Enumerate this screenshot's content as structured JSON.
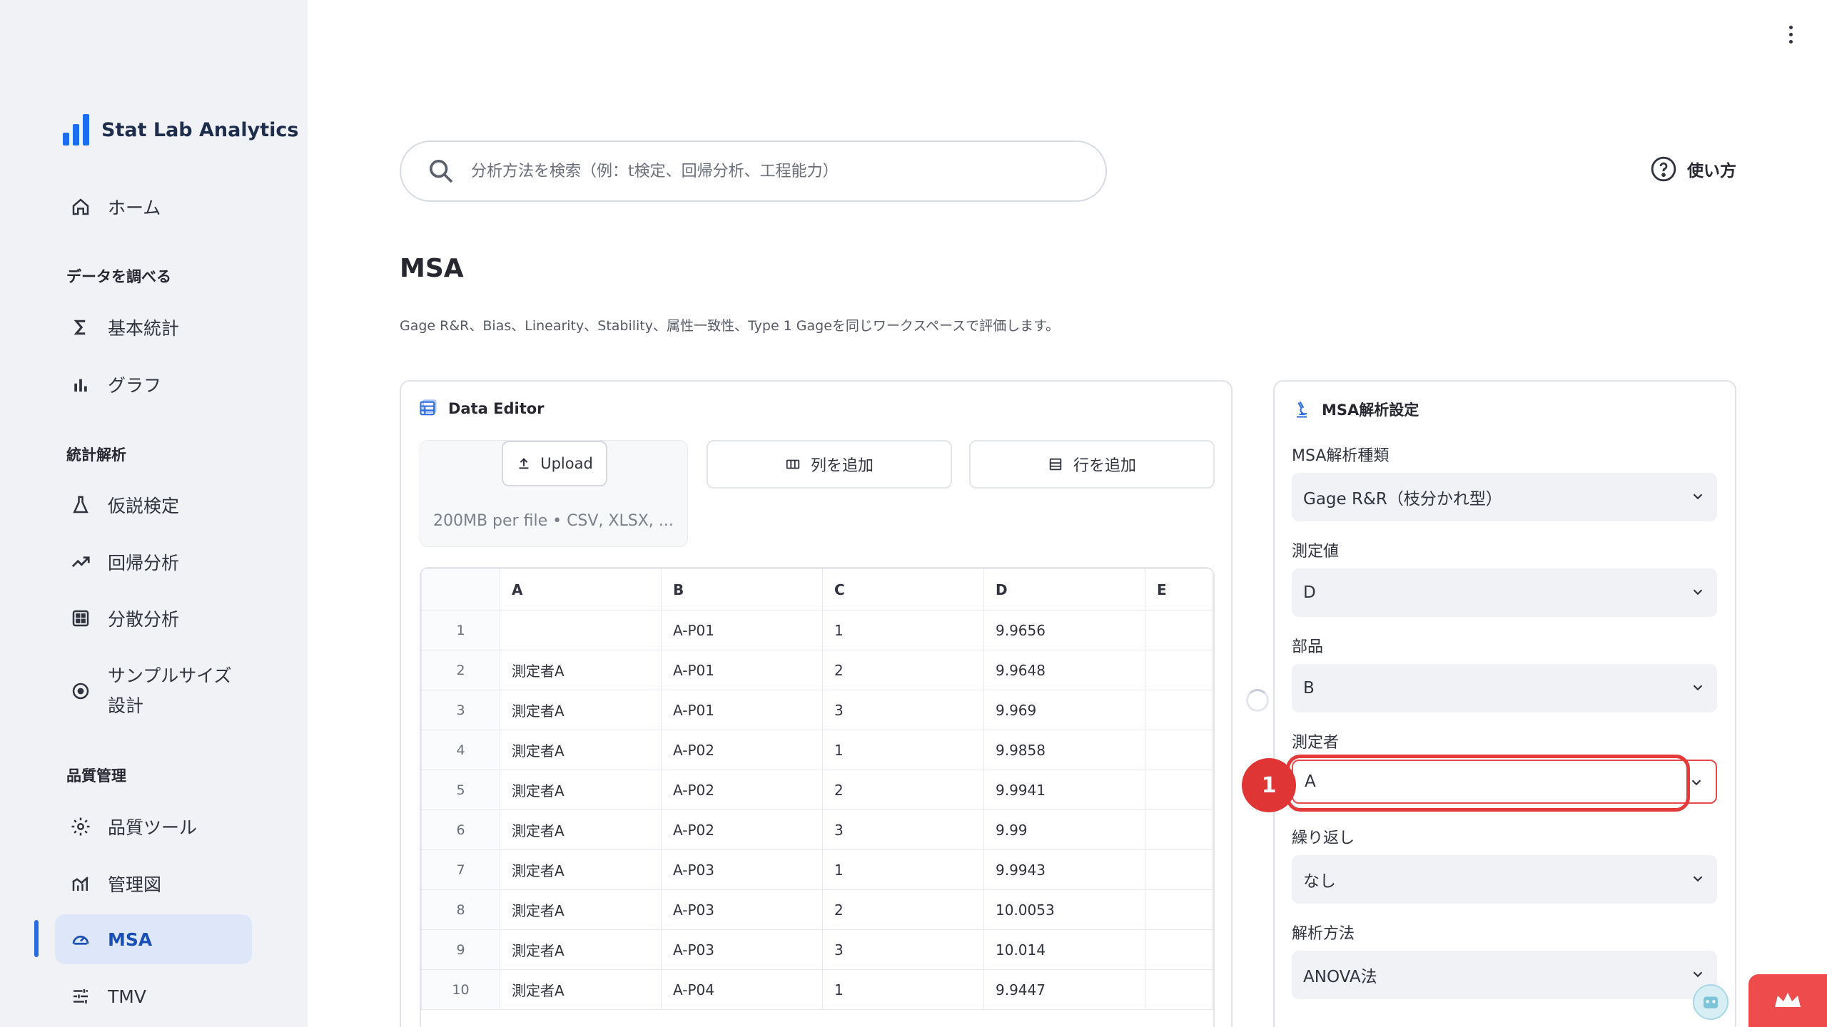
{
  "brand": {
    "name": "Stat Lab Analytics"
  },
  "sidebar": {
    "home": "ホーム",
    "section_explore": "データを調べる",
    "basic_stats": "基本統計",
    "graph": "グラフ",
    "section_stats": "統計解析",
    "hypothesis": "仮説検定",
    "regression": "回帰分析",
    "anova": "分散分析",
    "sample_size": "サンプルサイズ",
    "sample_size_2": "設計",
    "section_quality": "品質管理",
    "quality_tools": "品質ツール",
    "control_chart": "管理図",
    "msa": "MSA",
    "tmv": "TMV"
  },
  "search": {
    "placeholder": "分析方法を検索（例：t検定、回帰分析、工程能力）"
  },
  "help": {
    "label": "使い方"
  },
  "page": {
    "title": "MSA",
    "description": "Gage R&R、Bias、Linearity、Stability、属性一致性、Type 1 Gageを同じワークスペースで評価します。"
  },
  "editor": {
    "title": "Data Editor",
    "upload_label": "Upload",
    "upload_hint": "200MB per file • CSV, XLSX, ...",
    "add_column": "列を追加",
    "add_row": "行を追加",
    "columns": [
      "",
      "A",
      "B",
      "C",
      "D",
      "E"
    ],
    "rows": [
      [
        "1",
        "",
        "A-P01",
        "1",
        "9.9656",
        ""
      ],
      [
        "2",
        "測定者A",
        "A-P01",
        "2",
        "9.9648",
        ""
      ],
      [
        "3",
        "測定者A",
        "A-P01",
        "3",
        "9.969",
        ""
      ],
      [
        "4",
        "測定者A",
        "A-P02",
        "1",
        "9.9858",
        ""
      ],
      [
        "5",
        "測定者A",
        "A-P02",
        "2",
        "9.9941",
        ""
      ],
      [
        "6",
        "測定者A",
        "A-P02",
        "3",
        "9.99",
        ""
      ],
      [
        "7",
        "測定者A",
        "A-P03",
        "1",
        "9.9943",
        ""
      ],
      [
        "8",
        "測定者A",
        "A-P03",
        "2",
        "10.0053",
        ""
      ],
      [
        "9",
        "測定者A",
        "A-P03",
        "3",
        "10.014",
        ""
      ],
      [
        "10",
        "測定者A",
        "A-P04",
        "1",
        "9.9447",
        ""
      ]
    ]
  },
  "settings": {
    "title": "MSA解析設定",
    "type_label": "MSA解析種類",
    "type_value": "Gage R&R（枝分かれ型）",
    "measure_label": "測定値",
    "measure_value": "D",
    "part_label": "部品",
    "part_value": "B",
    "operator_label": "測定者",
    "operator_value": "A",
    "repeat_label": "繰り返し",
    "repeat_value": "なし",
    "method_label": "解析方法",
    "method_value": "ANOVA法"
  },
  "annotation": {
    "number": "1"
  },
  "colors": {
    "accent": "#1c6df2",
    "highlight": "#e53a3a",
    "sidebar_bg": "#f0f2f6"
  }
}
